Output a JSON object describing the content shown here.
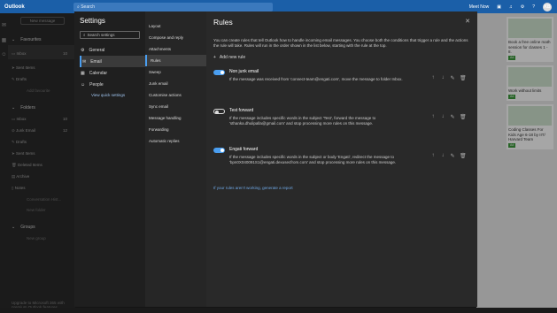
{
  "topbar": {
    "app": "Outlook",
    "search": "Search",
    "meet_now": "Meet Now",
    "avatar": "KB"
  },
  "folders": {
    "new_message": "New message",
    "favourites": "Favourites",
    "fav_items": [
      {
        "label": "Inbox",
        "count": "10",
        "icon": "inbox-icon",
        "selected": true
      },
      {
        "label": "Sent Items",
        "count": "",
        "icon": "send-icon"
      },
      {
        "label": "Drafts",
        "count": "",
        "icon": "pencil-icon"
      }
    ],
    "add_favourite": "Add favourite",
    "folders_title": "Folders",
    "folder_items": [
      {
        "label": "Inbox",
        "count": "10",
        "icon": "inbox-icon"
      },
      {
        "label": "Junk Email",
        "count": "12",
        "icon": "junk-icon"
      },
      {
        "label": "Drafts",
        "count": "",
        "icon": "pencil-icon"
      },
      {
        "label": "Sent Items",
        "count": "",
        "icon": "send-icon"
      },
      {
        "label": "Deleted Items",
        "count": "",
        "icon": "trash-icon"
      },
      {
        "label": "Archive",
        "count": "",
        "icon": "archive-icon"
      },
      {
        "label": "Notes",
        "count": "",
        "icon": "note-icon"
      }
    ],
    "conversation_history": "Conversation Hist...",
    "new_folder": "New folder",
    "groups": "Groups",
    "new_group": "New group",
    "upgrade": "Upgrade to Microsoft 365 with premium Outlook features"
  },
  "settings": {
    "title": "Settings",
    "search_placeholder": "Search settings",
    "categories": [
      {
        "label": "General",
        "icon": "gear-icon"
      },
      {
        "label": "Email",
        "icon": "mail-icon",
        "selected": true
      },
      {
        "label": "Calendar",
        "icon": "calendar-icon"
      },
      {
        "label": "People",
        "icon": "people-icon"
      }
    ],
    "quick_settings": "View quick settings",
    "subcategories": [
      "Layout",
      "Compose and reply",
      "Attachments",
      "Rules",
      "Sweep",
      "Junk email",
      "Customise actions",
      "Sync email",
      "Message handling",
      "Forwarding",
      "Automatic replies"
    ],
    "selected_subcategory": "Rules"
  },
  "rules": {
    "title": "Rules",
    "description": "You can create rules that tell Outlook how to handle incoming email messages. You choose both the conditions that trigger a rule and the actions the rule will take. Rules will run in the order shown in the list below, starting with the rule at the top.",
    "add_new_rule": "Add new rule",
    "items": [
      {
        "name": "Non junk email",
        "enabled": true,
        "desc": "If the message was received from 'connect-team@engati.com', move the message to folder Inbox."
      },
      {
        "name": "Test forward",
        "enabled": false,
        "desc": "If the message includes specific words in the subject 'Test', forward the message to 'sthanka.dhulipalla@gmail.com' and stop processing more rules on this message."
      },
      {
        "name": "Engati forward",
        "enabled": true,
        "desc": "If the message includes specific words in the subject or body 'Engati', redirect the message to 'bpn0X040091S1@engati.dexusecfrom.com' and stop processing more rules on this message."
      }
    ],
    "help_link": "If your rules aren't working, generate a report"
  },
  "ads": [
    {
      "text": "Book a free online math session for classes 1 - 8.",
      "tag": "Ad"
    },
    {
      "text": "Work without limits",
      "tag": "Ad"
    },
    {
      "text": "Coding Classes For Kids Age 6-18 by IIT/ Harvard Team",
      "tag": "Ad"
    }
  ],
  "colors": {
    "accent": "#4a9ef0",
    "topbar": "#1b5fa8"
  }
}
